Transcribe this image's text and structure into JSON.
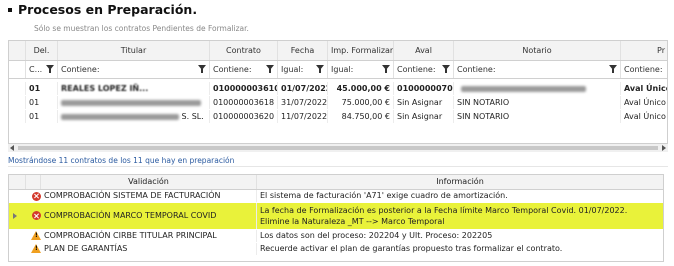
{
  "header": {
    "title": "Procesos en Preparación.",
    "subtitle": "Sólo se muestran los contratos Pendientes de Formalizar."
  },
  "contracts_grid": {
    "columns": [
      "Del.",
      "Titular",
      "Contrato",
      "Fecha",
      "Imp. Formalizar",
      "Aval",
      "Notario",
      "Pr"
    ],
    "filters": [
      "C...",
      "Contiene:",
      "Contiene:",
      "Igual:",
      "Igual:",
      "Contiene:",
      "Contiene:",
      "Contiene:"
    ],
    "rows": [
      {
        "del": "01",
        "titular": "REALES LOPEZ IÑ...",
        "contrato": "010000003610",
        "fecha": "01/07/2022",
        "importe": "45.000,00 €",
        "aval": "010000007096",
        "notario": "",
        "pr": "Aval Único a"
      },
      {
        "del": "01",
        "titular": "",
        "contrato": "010000003618",
        "fecha": "31/07/2022",
        "importe": "75.000,00 €",
        "aval": "Sin Asignar",
        "notario": "SIN NOTARIO",
        "pr": "Aval Único a"
      },
      {
        "del": "01",
        "titular": "S. SL.",
        "contrato": "010000003620",
        "fecha": "11/07/2022",
        "importe": "84.750,00 €",
        "aval": "Sin Asignar",
        "notario": "SIN NOTARIO",
        "pr": "Aval Único a"
      }
    ]
  },
  "status": {
    "count_text": "Mostrándose 11 contratos de los 11 que hay en preparación"
  },
  "validation_grid": {
    "columns": [
      "Validación",
      "Información"
    ],
    "rows": [
      {
        "icon": "error-icon",
        "validacion": "COMPROBACIÓN SISTEMA DE FACTURACIÓN",
        "info": [
          "El sistema de facturación 'A71' exige cuadro de amortización."
        ],
        "highlight": false
      },
      {
        "icon": "error-icon",
        "validacion": "COMPROBACIÓN MARCO TEMPORAL COVID",
        "info": [
          "La fecha de Formalización es posterior a la Fecha límite Marco Temporal Covid. 01/07/2022.",
          "Elimine la Naturaleza _MT --> Marco Temporal"
        ],
        "highlight": true
      },
      {
        "icon": "warning-icon",
        "validacion": "COMPROBACIÓN CIRBE TITULAR PRINCIPAL",
        "info": [
          "Los datos son del proceso: 202204 y Ult. Proceso: 202205"
        ],
        "highlight": false
      },
      {
        "icon": "warning-icon",
        "validacion": "PLAN DE GARANTÍAS",
        "info": [
          "Recuerde activar el plan de garantías propuesto tras formalizar el contrato."
        ],
        "highlight": false
      }
    ]
  },
  "colors": {
    "highlight": "#e9f23a",
    "error": "#d33a2c",
    "warning": "#f0a020",
    "link": "#2a5aa0"
  }
}
